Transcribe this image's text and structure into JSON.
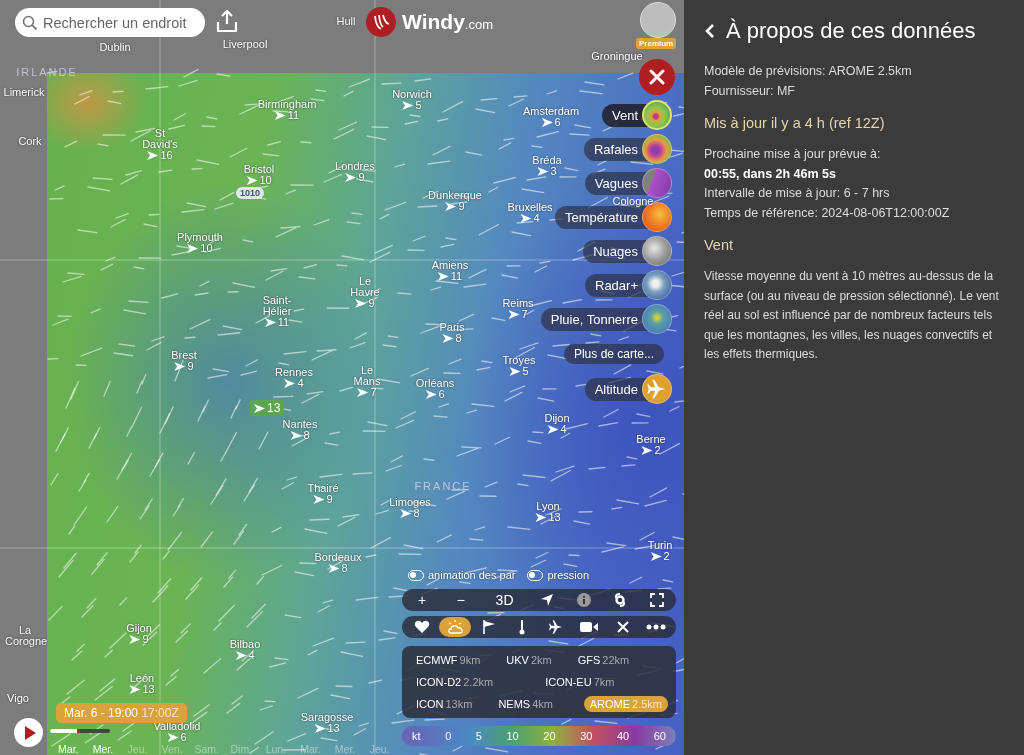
{
  "header": {
    "search": {
      "placeholder": "Rechercher un endroit"
    },
    "logo": {
      "name": "Windy",
      "suffix": ".com"
    },
    "account_badge": "Premium"
  },
  "map": {
    "places": [
      {
        "name": "Dublin"
      },
      {
        "name": "Liverpool"
      },
      {
        "name": "Hull"
      },
      {
        "name": "Limerick"
      },
      {
        "name": "Cork"
      },
      {
        "name": "Groningue"
      },
      {
        "name": "Birmingham",
        "wind": "11"
      },
      {
        "name": "Norwich",
        "wind": "5"
      },
      {
        "name": "Amsterdam",
        "wind": "6"
      },
      {
        "name": "St David's",
        "wind": "16"
      },
      {
        "name": "Bristol",
        "wind": "10"
      },
      {
        "name": "Londres",
        "wind": "9"
      },
      {
        "name": "Bréda",
        "wind": "3"
      },
      {
        "name": "Dunkerque",
        "wind": "9"
      },
      {
        "name": "Bruxelles",
        "wind": "4"
      },
      {
        "name": "Cologne"
      },
      {
        "name": "Plymouth",
        "wind": "10"
      },
      {
        "name": "Amiens",
        "wind": "11"
      },
      {
        "name": "Le Havre",
        "wind": "9"
      },
      {
        "name": "Reims",
        "wind": "7"
      },
      {
        "name": "Saint-Hélier",
        "wind": "11"
      },
      {
        "name": "Paris",
        "wind": "8"
      },
      {
        "name": "Troyes",
        "wind": "5"
      },
      {
        "name": "Brest",
        "wind": "9"
      },
      {
        "name": "Rennes",
        "wind": "4"
      },
      {
        "name": "Le Mans",
        "wind": "7"
      },
      {
        "name": "Orléans",
        "wind": "6"
      },
      {
        "name": "Dijon",
        "wind": "4"
      },
      {
        "name": "Nantes",
        "wind": "8"
      },
      {
        "name": "Berne",
        "wind": "2"
      },
      {
        "name": "Thairé",
        "wind": "9"
      },
      {
        "name": "Limoges",
        "wind": "8"
      },
      {
        "name": "Lyon",
        "wind": "13"
      },
      {
        "name": "Bordeaux",
        "wind": "8"
      },
      {
        "name": "Turin",
        "wind": "2"
      },
      {
        "name": "Gijon",
        "wind": "9"
      },
      {
        "name": "Bilbao",
        "wind": "4"
      },
      {
        "name": "La Corogne"
      },
      {
        "name": "León",
        "wind": "13"
      },
      {
        "name": "Vigo"
      },
      {
        "name": "Valladolid",
        "wind": "6"
      },
      {
        "name": "Saragosse",
        "wind": "13"
      }
    ],
    "region_labels": [
      "IRLANDE",
      "FRANCE"
    ],
    "isobar_label": "1010",
    "wind_badge": "13"
  },
  "layers": [
    {
      "label": "Vent",
      "kind": "wind",
      "selected": true
    },
    {
      "label": "Rafales",
      "kind": "gusts",
      "selected": false
    },
    {
      "label": "Vagues",
      "kind": "waves",
      "selected": false
    },
    {
      "label": "Température",
      "kind": "temperature",
      "selected": false
    },
    {
      "label": "Nuages",
      "kind": "clouds",
      "selected": false
    },
    {
      "label": "Radar+",
      "kind": "radar",
      "selected": false
    },
    {
      "label": "Pluie, Tonnerre",
      "kind": "rain",
      "selected": false
    },
    {
      "label": "Plus de carte...",
      "kind": "more",
      "selected": false
    },
    {
      "label": "Altitude",
      "kind": "altitude",
      "selected": false
    }
  ],
  "toggles": [
    {
      "label": "animation des par",
      "on": false
    },
    {
      "label": "pression",
      "on": false
    }
  ],
  "map_controls": [
    {
      "kind": "text",
      "label": "+"
    },
    {
      "kind": "text",
      "label": "−"
    },
    {
      "kind": "text",
      "label": "3D"
    },
    {
      "kind": "locate"
    },
    {
      "kind": "info"
    },
    {
      "kind": "hurricane"
    },
    {
      "kind": "fullscreen"
    }
  ],
  "quick_menu": [
    {
      "kind": "heart",
      "selected": false
    },
    {
      "kind": "weather",
      "selected": true
    },
    {
      "kind": "flag",
      "selected": false
    },
    {
      "kind": "thermometer",
      "selected": false
    },
    {
      "kind": "plane",
      "selected": false
    },
    {
      "kind": "camera",
      "selected": false
    },
    {
      "kind": "close",
      "selected": false
    },
    {
      "kind": "more",
      "selected": false
    }
  ],
  "model_rows": [
    {
      "items": [
        {
          "name": "ECMWF",
          "resolution": "9km",
          "selected": false
        },
        {
          "name": "UKV",
          "resolution": "2km",
          "selected": false
        },
        {
          "name": "GFS",
          "resolution": "22km",
          "selected": false
        }
      ]
    },
    {
      "items": [
        {
          "name": "ICON-D2",
          "resolution": "2.2km",
          "selected": false
        },
        {
          "name": "ICON-EU",
          "resolution": "7km",
          "selected": false
        }
      ]
    },
    {
      "items": [
        {
          "name": "ICON",
          "resolution": "13km",
          "selected": false
        },
        {
          "name": "NEMS",
          "resolution": "4km",
          "selected": false
        },
        {
          "name": "AROME",
          "resolution": "2.5km",
          "selected": true
        }
      ]
    }
  ],
  "legend": {
    "unit": "kt",
    "ticks": [
      "0",
      "5",
      "10",
      "20",
      "30",
      "40",
      "60"
    ]
  },
  "timeline": {
    "time": "Mar. 6 - 19:00",
    "utc": "17:00Z",
    "level": 0.5,
    "days": [
      {
        "label": "Mar.",
        "available": true
      },
      {
        "label": "Mer.",
        "available": true
      },
      {
        "label": "Jeu.",
        "available": false
      },
      {
        "label": "Ven.",
        "available": false
      },
      {
        "label": "Sam.",
        "available": false
      },
      {
        "label": "Dim.",
        "available": false
      },
      {
        "label": "Lun.",
        "available": false
      },
      {
        "label": "Mar.",
        "available": false
      },
      {
        "label": "Mer.",
        "available": false
      },
      {
        "label": "Jeu.",
        "available": false
      }
    ]
  },
  "panel": {
    "title": "À propos de ces données",
    "model_line": "Modèle de prévisions: AROME 2.5km",
    "provider_line": "Fournisseur: MF",
    "updated": "Mis à jour il y a 4 h (ref 12Z)",
    "next_update_label": "Prochaine mise à jour prévue à:",
    "next_update": "00:55,  dans 2h 46m 5s",
    "interval": "Intervalle de mise à jour: 6 - 7 hrs",
    "reference_time": "Temps de référence: 2024-08-06T12:00:00Z",
    "section_title": "Vent",
    "description": "Vitesse moyenne du vent à 10 mètres au-dessus de la surface (ou au niveau de pression sélectionné). Le vent réel au sol est influencé par de nombreux facteurs tels que les montagnes, les villes, les nuages convectifs et les effets thermiques."
  }
}
